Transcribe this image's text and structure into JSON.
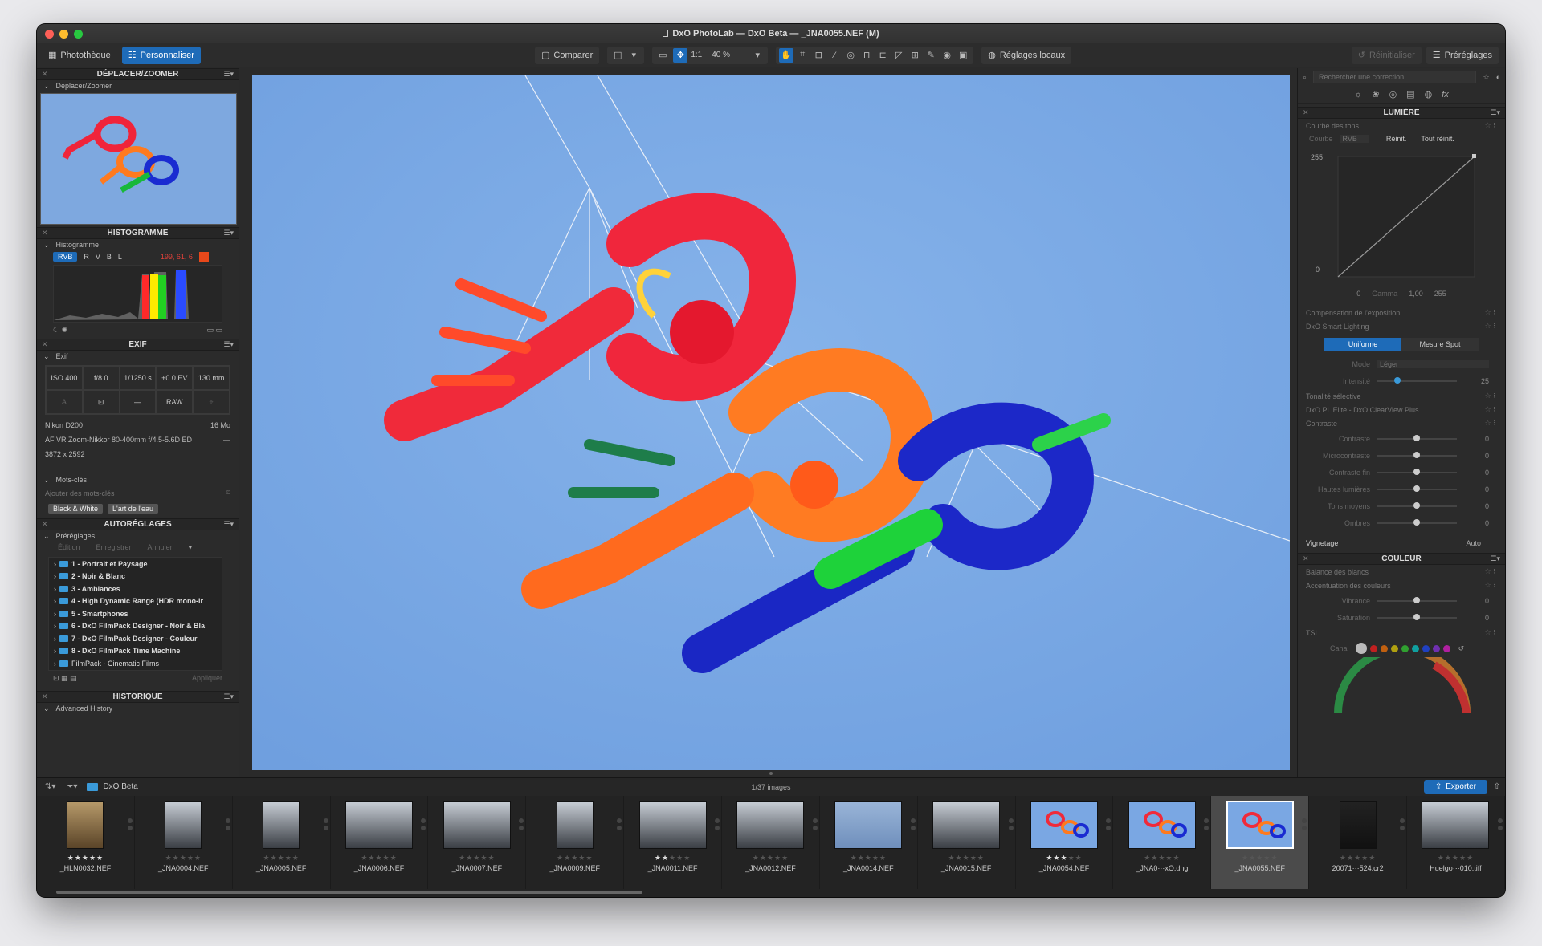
{
  "window": {
    "title": "DxO PhotoLab — DxO Beta — _JNA0055.NEF (M)"
  },
  "toolbar": {
    "tab_library": "Photothèque",
    "tab_customize": "Personnaliser",
    "compare": "Comparer",
    "ratio": "1:1",
    "zoom": "40 %",
    "local_adjust": "Réglages locaux",
    "reset": "Réinitialiser",
    "presets": "Préréglages"
  },
  "left": {
    "move_zoom": {
      "title": "DÉPLACER/ZOOMER",
      "sub": "Déplacer/Zoomer"
    },
    "histogram": {
      "title": "HISTOGRAMME",
      "sub": "Histogramme",
      "channels": [
        "RVB",
        "R",
        "V",
        "B",
        "L"
      ],
      "readout": "199, 61, 6"
    },
    "exif": {
      "title": "EXIF",
      "sub": "Exif",
      "row1": [
        "ISO 400",
        "f/8.0",
        "1/1250 s",
        "+0.0 EV",
        "130 mm"
      ],
      "row2": [
        "A",
        "",
        "—",
        "RAW",
        ""
      ],
      "camera": "Nikon D200",
      "size_mo": "16 Mo",
      "lens": "AF VR Zoom-Nikkor 80-400mm f/4.5-5.6D ED",
      "lens_extra": "—",
      "dims": "3872 x 2592"
    },
    "keywords": {
      "sub": "Mots-clés",
      "placeholder": "Ajouter des mots-clés",
      "tags": [
        "Black & White",
        "L'art de l'eau"
      ]
    },
    "presets": {
      "title": "AUTORÉGLAGES",
      "sub": "Préréglages",
      "actions": [
        "Édition",
        "Enregistrer",
        "Annuler"
      ],
      "items": [
        "1 - Portrait et Paysage",
        "2 - Noir & Blanc",
        "3 - Ambiances",
        "4 - High Dynamic Range (HDR mono-ir",
        "5 - Smartphones",
        "6 - DxO FilmPack Designer - Noir & Bla",
        "7 - DxO FilmPack Designer - Couleur",
        "8 - DxO FilmPack Time Machine",
        "FilmPack - Cinematic Films"
      ],
      "apply": "Appliquer"
    },
    "history": {
      "title": "HISTORIQUE",
      "sub": "Advanced History"
    }
  },
  "right": {
    "search_placeholder": "Rechercher une correction",
    "light": {
      "title": "LUMIÈRE",
      "tone_curve": "Courbe des tons",
      "curve_label": "Courbe",
      "curve_mode": "RVB",
      "reset": "Réinit.",
      "reset_all": "Tout réinit.",
      "max": "255",
      "min": "0",
      "in_min": "0",
      "gamma_label": "Gamma",
      "gamma": "1,00",
      "in_max": "255",
      "exposure": "Compensation de l'exposition",
      "smart_lighting": "DxO Smart Lighting",
      "uniform": "Uniforme",
      "spot": "Mesure Spot",
      "mode_label": "Mode",
      "mode": "Léger",
      "intensity_label": "Intensité",
      "intensity": "25",
      "selective_tone": "Tonalité sélective",
      "clearview": "DxO PL Elite - DxO ClearView Plus",
      "contrast": "Contraste",
      "contrast_sliders": [
        {
          "label": "Contraste",
          "value": "0"
        },
        {
          "label": "Microcontraste",
          "value": "0"
        },
        {
          "label": "Contraste fin",
          "value": "0"
        },
        {
          "label": "Hautes lumières",
          "value": "0"
        },
        {
          "label": "Tons moyens",
          "value": "0"
        },
        {
          "label": "Ombres",
          "value": "0"
        }
      ],
      "vignetting": "Vignetage",
      "vignetting_val": "Auto"
    },
    "color": {
      "title": "COULEUR",
      "wb": "Balance des blancs",
      "accent": "Accentuation des couleurs",
      "sliders": [
        {
          "label": "Vibrance",
          "value": "0"
        },
        {
          "label": "Saturation",
          "value": "0"
        }
      ],
      "hsl": "TSL",
      "channel": "Canal"
    }
  },
  "filmstrip": {
    "folder": "DxO Beta",
    "count": "1/37 images",
    "export": "Exporter",
    "thumbs": [
      {
        "name": "_HLN0032.NEF",
        "stars": "★★★★★",
        "kind": "tan"
      },
      {
        "name": "_JNA0004.NEF",
        "stars": "★★★★★",
        "kind": "grey"
      },
      {
        "name": "_JNA0005.NEF",
        "stars": "★★★★★",
        "kind": "grey"
      },
      {
        "name": "_JNA0006.NEF",
        "stars": "★★★★★",
        "kind": "grey"
      },
      {
        "name": "_JNA0007.NEF",
        "stars": "★★★★★",
        "kind": "grey"
      },
      {
        "name": "_JNA0009.NEF",
        "stars": "★★★★★",
        "kind": "grey"
      },
      {
        "name": "_JNA0011.NEF",
        "stars": "★★★★★",
        "kind": "grey"
      },
      {
        "name": "_JNA0012.NEF",
        "stars": "★★★★★",
        "kind": "grey"
      },
      {
        "name": "_JNA0014.NEF",
        "stars": "★★★★★",
        "kind": "sky"
      },
      {
        "name": "_JNA0015.NEF",
        "stars": "★★★★★",
        "kind": "grey"
      },
      {
        "name": "_JNA0054.NEF",
        "stars": "★★★★★",
        "kind": "kite"
      },
      {
        "name": "_JNA0···xO.dng",
        "stars": "★★★★★",
        "kind": "kite"
      },
      {
        "name": "_JNA0055.NEF",
        "stars": "★★★★★",
        "kind": "kite"
      },
      {
        "name": "20071···524.cr2",
        "stars": "★★★★★",
        "kind": "dark"
      },
      {
        "name": "Huelgo···010.tiff",
        "stars": "★★★★★",
        "kind": "grey"
      }
    ]
  },
  "ratings": [
    5,
    0,
    0,
    0,
    0,
    0,
    2,
    0,
    0,
    0,
    3,
    0,
    0,
    0,
    0
  ]
}
